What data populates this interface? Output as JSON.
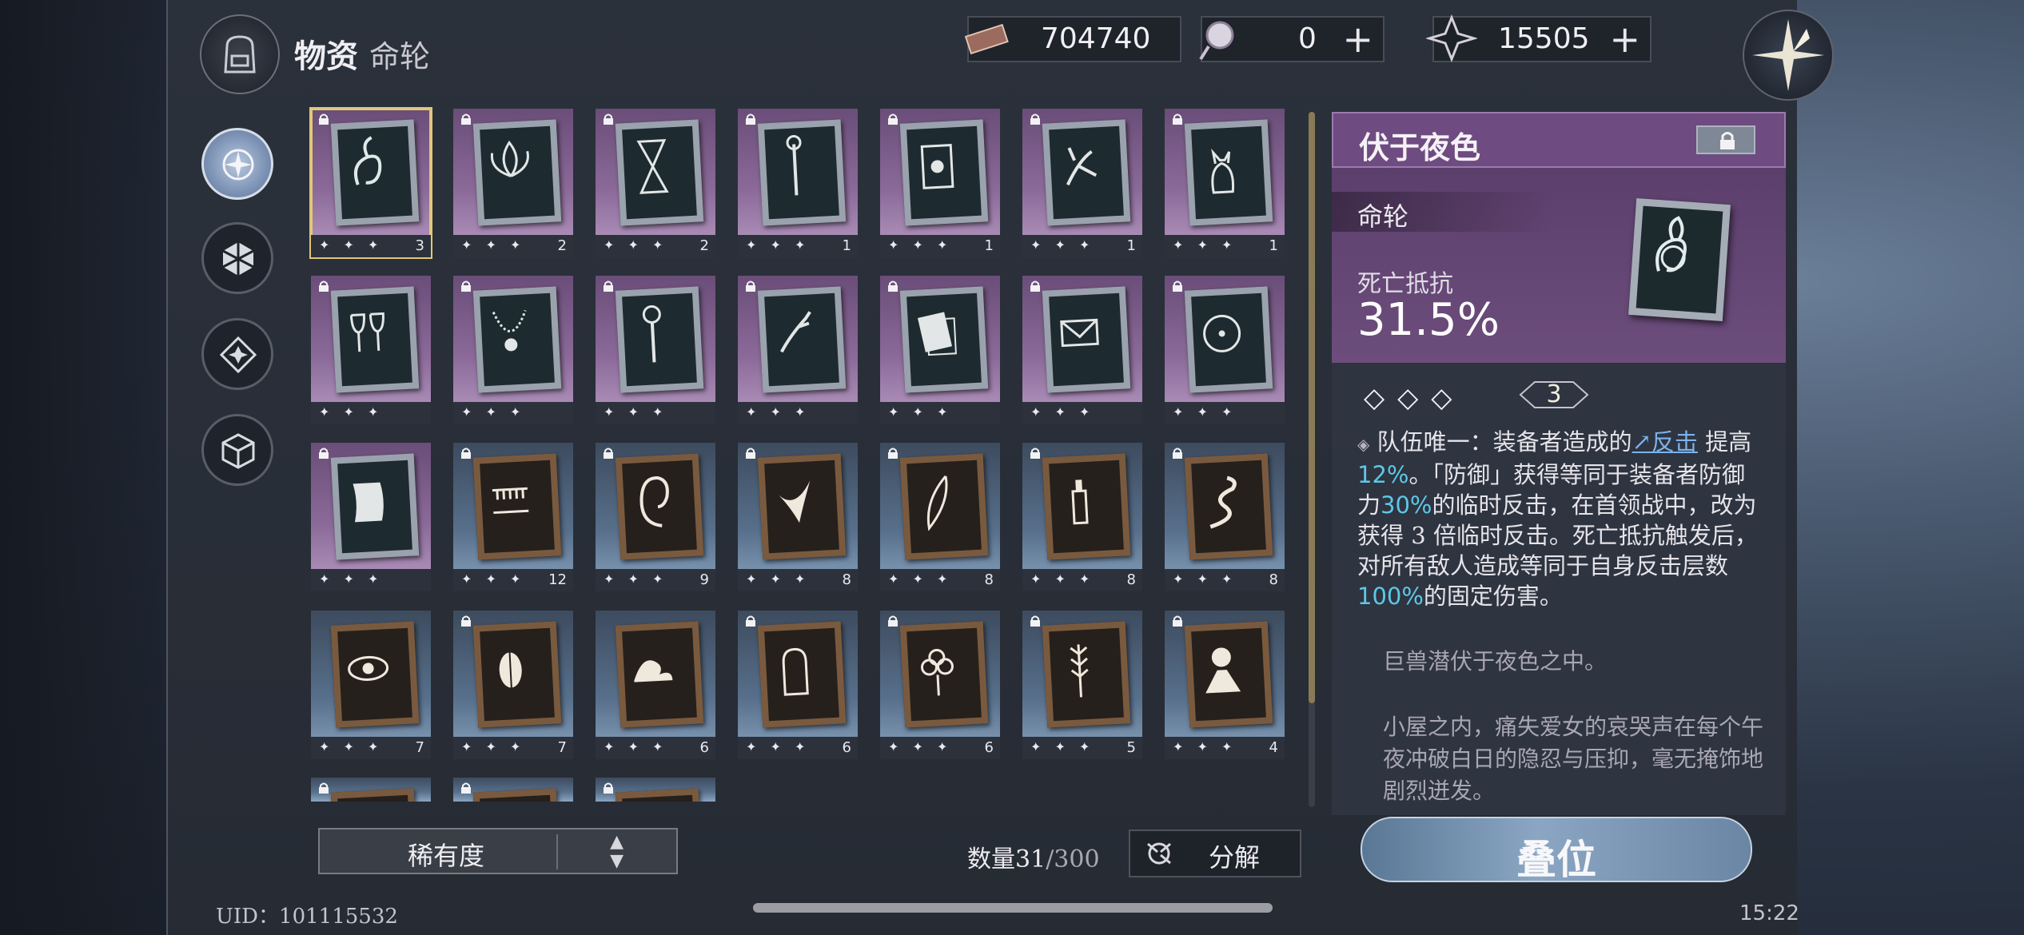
{
  "header": {
    "title": "物资",
    "subtitle": "命轮",
    "currencies": [
      {
        "icon": "ticket-icon",
        "value": "704740",
        "has_add": false
      },
      {
        "icon": "crystal-ball-icon",
        "value": "0",
        "has_add": true
      },
      {
        "icon": "star-shard-icon",
        "value": "15505",
        "has_add": true
      }
    ]
  },
  "nav": [
    "compass-rose-icon",
    "hexagon-icon",
    "diamond-star-icon",
    "cube-icon"
  ],
  "cards": [
    {
      "art": "fox-spirit",
      "theme": "purple",
      "stars": "✦ ✦ ✦",
      "count": "3",
      "locked": true,
      "selected": true
    },
    {
      "art": "lotus",
      "theme": "purple",
      "stars": "✦ ✦ ✦",
      "count": "2",
      "locked": true
    },
    {
      "art": "hourglass",
      "theme": "purple",
      "stars": "✦ ✦ ✦",
      "count": "2",
      "locked": true
    },
    {
      "art": "scepter",
      "theme": "purple",
      "stars": "✦ ✦ ✦",
      "count": "1",
      "locked": true
    },
    {
      "art": "tarot",
      "theme": "purple",
      "stars": "✦ ✦ ✦",
      "count": "1",
      "locked": true
    },
    {
      "art": "dancer",
      "theme": "purple",
      "stars": "✦ ✦ ✦",
      "count": "1",
      "locked": true
    },
    {
      "art": "cat",
      "theme": "purple",
      "stars": "✦ ✦ ✦",
      "count": "1",
      "locked": true
    },
    {
      "art": "goblets",
      "theme": "purple",
      "stars": "✦ ✦ ✦",
      "count": "",
      "locked": true
    },
    {
      "art": "necklace",
      "theme": "purple",
      "stars": "✦ ✦ ✦",
      "count": "",
      "locked": true
    },
    {
      "art": "key",
      "theme": "purple",
      "stars": "✦ ✦ ✦",
      "count": "",
      "locked": true
    },
    {
      "art": "hand",
      "theme": "purple",
      "stars": "✦ ✦ ✦",
      "count": "",
      "locked": true
    },
    {
      "art": "letters",
      "theme": "purple",
      "stars": "✦ ✦ ✦",
      "count": "",
      "locked": true
    },
    {
      "art": "envelope",
      "theme": "purple",
      "stars": "✦ ✦ ✦",
      "count": "",
      "locked": true
    },
    {
      "art": "clock-face",
      "theme": "purple",
      "stars": "✦ ✦ ✦",
      "count": "",
      "locked": true
    },
    {
      "art": "scroll",
      "theme": "purple",
      "stars": "✦ ✦ ✦",
      "count": "",
      "locked": true
    },
    {
      "art": "teeth",
      "theme": "blue",
      "stars": "✦ ✦ ✦",
      "count": "12",
      "locked": true
    },
    {
      "art": "ear",
      "theme": "blue",
      "stars": "✦ ✦ ✦",
      "count": "9",
      "locked": true
    },
    {
      "art": "dove",
      "theme": "blue",
      "stars": "✦ ✦ ✦",
      "count": "8",
      "locked": true
    },
    {
      "art": "feather",
      "theme": "blue",
      "stars": "✦ ✦ ✦",
      "count": "8",
      "locked": true
    },
    {
      "art": "bottle",
      "theme": "blue",
      "stars": "✦ ✦ ✦",
      "count": "8",
      "locked": true
    },
    {
      "art": "serpent",
      "theme": "blue",
      "stars": "✦ ✦ ✦",
      "count": "8",
      "locked": true
    },
    {
      "art": "eye",
      "theme": "blue",
      "stars": "✦ ✦ ✦",
      "count": "7",
      "locked": false
    },
    {
      "art": "beetle",
      "theme": "blue",
      "stars": "✦ ✦ ✦",
      "count": "7",
      "locked": true
    },
    {
      "art": "wave",
      "theme": "blue",
      "stars": "✦ ✦ ✦",
      "count": "6",
      "locked": false
    },
    {
      "art": "tombstone",
      "theme": "blue",
      "stars": "✦ ✦ ✦",
      "count": "6",
      "locked": true
    },
    {
      "art": "flower",
      "theme": "blue",
      "stars": "✦ ✦ ✦",
      "count": "6",
      "locked": true
    },
    {
      "art": "wheat",
      "theme": "blue",
      "stars": "✦ ✦ ✦",
      "count": "5",
      "locked": true
    },
    {
      "art": "volcano",
      "theme": "blue",
      "stars": "✦ ✦ ✦",
      "count": "4",
      "locked": true
    },
    {
      "art": "partial",
      "theme": "blue",
      "stars": "",
      "count": "",
      "locked": true
    },
    {
      "art": "partial",
      "theme": "blue",
      "stars": "",
      "count": "",
      "locked": true
    },
    {
      "art": "partial",
      "theme": "blue",
      "stars": "",
      "count": "",
      "locked": true
    }
  ],
  "sort": {
    "label": "稀有度"
  },
  "quantity": {
    "prefix": "数量",
    "current": "31",
    "total": "/300"
  },
  "decompose": {
    "label": "分解"
  },
  "detail": {
    "name": "伏于夜色",
    "type": "命轮",
    "stat_label": "死亡抵抗",
    "stat_value": "31.5%",
    "stars": "◇◇◇",
    "level": "3",
    "desc_parts": {
      "p1": "队伍唯一：装备者造成的",
      "link": "↗反击",
      "p2": "提高",
      "v1": "12%",
      "p3": "。「防御」获得等同于装备者防御力",
      "v2": "30%",
      "p4": "的临时反击，在首领战中，改为获得 3 倍临时反击。死亡抵抗触发后，对所有敌人造成等同于自身反击层数",
      "v3": "100%",
      "p5": "的固定伤害。"
    },
    "flavor1": "巨兽潜伏于夜色之中。",
    "flavor2": "小屋之内，痛失爱女的哀哭声在每个午夜冲破白日的隐忍与压抑，毫无掩饰地剧烈迸发。"
  },
  "stack_button": "叠位",
  "uid": "UID：101115532",
  "time": "15:22",
  "colors": {
    "purple_card": "#8b6a99",
    "blue_card": "#58708c",
    "highlight": "#5ec7e6",
    "selected": "#e2c77a"
  }
}
